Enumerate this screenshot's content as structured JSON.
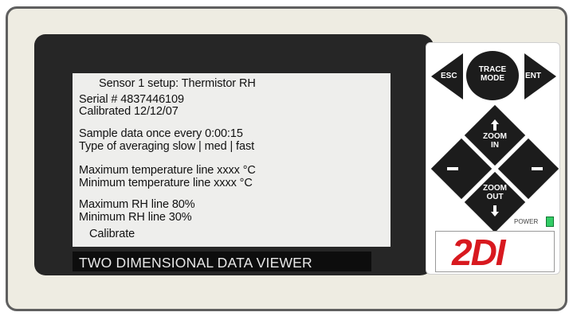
{
  "screen": {
    "lines": [
      "Sensor 1 setup:  Thermistor  RH",
      "Serial #  4837446109",
      "Calibrated 12/12/07",
      "Sample data once every  0:00:15",
      "Type of averaging  slow | med | fast",
      "Maximum temperature line    xxxx °C",
      "Minimum temperature line    xxxx °C",
      "Maximum RH line   80%",
      "Minimum  RH line   30%",
      "Calibrate"
    ]
  },
  "title_bar": {
    "label": "TWO DIMENSIONAL DATA VIEWER"
  },
  "buttons": {
    "esc": "ESC",
    "trace_mode_1": "TRACE",
    "trace_mode_2": "MODE",
    "ent": "ENT",
    "zoom_in_1": "ZOOM",
    "zoom_in_2": "IN",
    "zoom_out_1": "ZOOM",
    "zoom_out_2": "OUT"
  },
  "power": {
    "label": "POWER",
    "led_color": "#33cc66"
  },
  "logo": {
    "text": "2DI"
  }
}
